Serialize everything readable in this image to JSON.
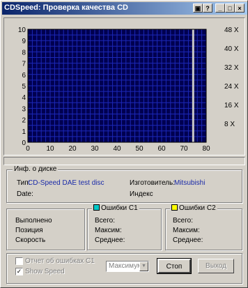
{
  "window": {
    "title": "CDSpeed: Проверка качества CD"
  },
  "titlebar_buttons": {
    "b1": "▣",
    "b2": "?",
    "minimize": "_",
    "maximize": "□",
    "close": "×"
  },
  "chart_data": {
    "type": "line",
    "x_ticks": [
      "0",
      "10",
      "20",
      "30",
      "40",
      "50",
      "60",
      "70",
      "80"
    ],
    "y_left_ticks": [
      "10",
      "9",
      "8",
      "7",
      "6",
      "5",
      "4",
      "3",
      "2",
      "1",
      "0"
    ],
    "y_right_ticks": [
      "48 X",
      "40 X",
      "32 X",
      "24 X",
      "16 X",
      "8 X"
    ],
    "xlim": [
      0,
      80
    ],
    "ylim": [
      0,
      10
    ],
    "y_right_lim": [
      0,
      48
    ],
    "grid": true,
    "cursor_x": 74,
    "series": []
  },
  "disc_info": {
    "group_label": "Инф. о диске",
    "type_label": "Тип:",
    "type_value": "CD-Speed DAE test disc",
    "date_label": "Date:",
    "date_value": "",
    "manufacturer_label": "Изготовитель:",
    "manufacturer_value": "Mitsubishi",
    "index_label": "Индекс",
    "index_value": ""
  },
  "progress": {
    "completed_label": "Выполнено",
    "position_label": "Позиция",
    "speed_label": "Скорость"
  },
  "c1": {
    "label": "Ошибки С1",
    "color": "#00c8c8",
    "total_label": "Всего:",
    "max_label": "Максим:",
    "avg_label": "Среднее:"
  },
  "c2": {
    "label": "Ошибки С2",
    "color": "#ffff00",
    "total_label": "Всего:",
    "max_label": "Максим:",
    "avg_label": "Среднее:"
  },
  "options": {
    "report_label": "Отчет об ошибках С1",
    "show_speed_label": "Show Speed",
    "speed_select_value": "Максимум",
    "stop_label": "Стоп",
    "exit_label": "Выход"
  }
}
